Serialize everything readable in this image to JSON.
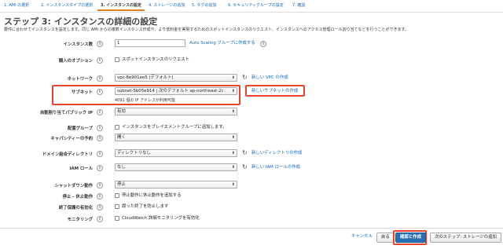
{
  "wizard_tabs": [
    {
      "label": "1. AMI の選択",
      "active": false
    },
    {
      "label": "2. インスタンスタイプの選択",
      "active": false
    },
    {
      "label": "3. インスタンスの設定",
      "active": true
    },
    {
      "label": "4. ストレージの追加",
      "active": false
    },
    {
      "label": "5. タグの追加",
      "active": false
    },
    {
      "label": "6. セキュリティグループの設定",
      "active": false
    },
    {
      "label": "7. 確認",
      "active": false
    }
  ],
  "page": {
    "title": "ステップ 3: インスタンスの詳細の設定",
    "description": "要件に合わせてインスタンスを設定します。同じ AMI からの複数インスタンス作成や、より低料金を実現するためのスポットインスタンスのリクエスト、インスタンスへのアクセス管理ロール割り当てなどを行うことができます。"
  },
  "fields": {
    "instance_count": {
      "label": "インスタンス数",
      "value": "1",
      "link": "Auto Scaling グループに作成する"
    },
    "purchase_option": {
      "label": "購入のオプション",
      "checkbox": "スポットインスタンスのリクエスト"
    },
    "network": {
      "label": "ネットワーク",
      "value": "vpc-8e901ee5 (デフォルト)",
      "link": "新しい VPC の作成"
    },
    "subnet": {
      "label": "サブネット",
      "value": "subnet-5b05e914 | 次のデフォルト ap-northeast-2c",
      "link": "新しいサブネットの作成",
      "subtext": "4091 個の IP アドレスが利用可能"
    },
    "auto_public_ip": {
      "label": "自動割り当てパブリック IP",
      "value": "有効"
    },
    "placement_group": {
      "label": "配置グループ",
      "checkbox": "インスタンスをプレイスメントグループに追加します。"
    },
    "capacity_reservation": {
      "label": "キャパシティーの予約",
      "value": "開く"
    },
    "domain_directory": {
      "label": "ドメイン結合ディレクトリ",
      "value": "ディレクトリなし",
      "link": "新しいディレクトリの作成"
    },
    "iam_role": {
      "label": "IAM ロール",
      "value": "なし",
      "link": "新しい IAM ロールの作成"
    },
    "shutdown_behavior": {
      "label": "シャットダウン動作",
      "value": "停止"
    },
    "stop_hibernate": {
      "label": "停止 - 休止動作",
      "checkbox": "停止動作に休止動作を追加する"
    },
    "termination_protection": {
      "label": "終了保護の有効化",
      "checkbox": "誤った終了を防止します"
    },
    "monitoring": {
      "label": "モニタリング",
      "checkbox": "CloudWatch 詳細モニタリングを有効化"
    }
  },
  "footer": {
    "cancel": "キャンセル",
    "back": "戻る",
    "review": "確認と作成",
    "next": "次のステップ: ストレージの追加"
  },
  "colors": {
    "accent": "#e77c22",
    "link": "#1166bb",
    "highlight": "#e8452c",
    "primary_button": "#2a6fb3"
  },
  "icons": {
    "info": "info-icon",
    "refresh": "refresh-icon",
    "dropdown": "chevron-down-icon"
  }
}
